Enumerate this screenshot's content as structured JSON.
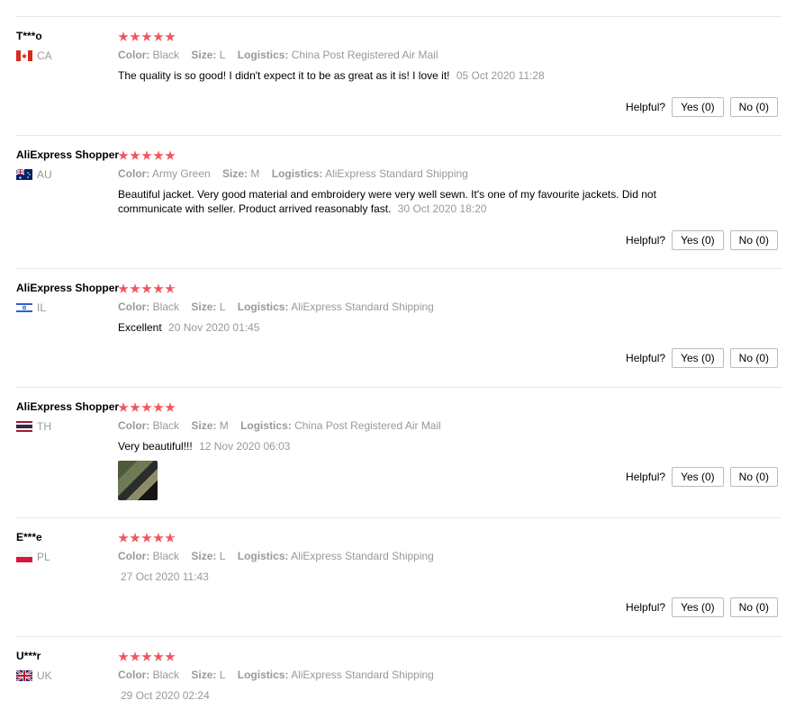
{
  "helpful_label": "Helpful?",
  "reviews": [
    {
      "user": "T***o",
      "country": "CA",
      "flag": "ca",
      "stars": 5,
      "color_label": "Color:",
      "color": "Black",
      "size_label": "Size:",
      "size": "L",
      "logistics_label": "Logistics:",
      "logistics": "China Post Registered Air Mail",
      "text": "The quality is so good! I didn't expect it to be as great as it is! I love it!",
      "date": "05 Oct 2020 11:28",
      "yes": "Yes (0)",
      "no": "No (0)"
    },
    {
      "user": "AliExpress Shopper",
      "country": "AU",
      "flag": "au",
      "stars": 5,
      "color_label": "Color:",
      "color": "Army Green",
      "size_label": "Size:",
      "size": "M",
      "logistics_label": "Logistics:",
      "logistics": "AliExpress Standard Shipping",
      "text": "Beautiful jacket. Very good material and embroidery were very well sewn. It's one of my favourite jackets. Did not communicate with seller. Product arrived reasonably fast.",
      "date": "30 Oct 2020 18:20",
      "yes": "Yes (0)",
      "no": "No (0)"
    },
    {
      "user": "AliExpress Shopper",
      "country": "IL",
      "flag": "il",
      "stars": 4.5,
      "color_label": "Color:",
      "color": "Black",
      "size_label": "Size:",
      "size": "L",
      "logistics_label": "Logistics:",
      "logistics": "AliExpress Standard Shipping",
      "text": "Excellent",
      "date": "20 Nov 2020 01:45",
      "yes": "Yes (0)",
      "no": "No (0)"
    },
    {
      "user": "AliExpress Shopper",
      "country": "TH",
      "flag": "th",
      "stars": 5,
      "color_label": "Color:",
      "color": "Black",
      "size_label": "Size:",
      "size": "M",
      "logistics_label": "Logistics:",
      "logistics": "China Post Registered Air Mail",
      "text": "Very beautiful!!!",
      "date": "12 Nov 2020 06:03",
      "has_photo": true,
      "yes": "Yes (0)",
      "no": "No (0)"
    },
    {
      "user": "E***e",
      "country": "PL",
      "flag": "pl",
      "stars": 4.5,
      "color_label": "Color:",
      "color": "Black",
      "size_label": "Size:",
      "size": "L",
      "logistics_label": "Logistics:",
      "logistics": "AliExpress Standard Shipping",
      "text": "",
      "date": "27 Oct 2020 11:43",
      "yes": "Yes (0)",
      "no": "No (0)"
    },
    {
      "user": "U***r",
      "country": "UK",
      "flag": "uk",
      "stars": 5,
      "color_label": "Color:",
      "color": "Black",
      "size_label": "Size:",
      "size": "L",
      "logistics_label": "Logistics:",
      "logistics": "AliExpress Standard Shipping",
      "text": "",
      "date": "29 Oct 2020 02:24"
    }
  ],
  "colors": {
    "star": "#f0565f",
    "muted": "#999999",
    "divider": "#e6e6e6"
  }
}
